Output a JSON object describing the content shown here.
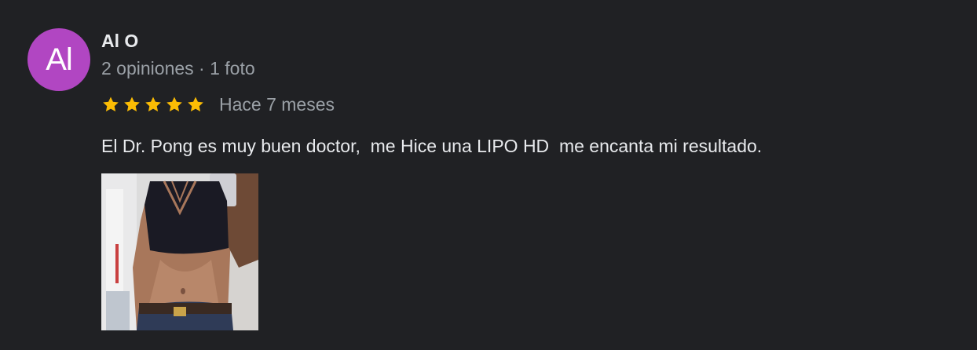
{
  "review": {
    "avatar_initials": "Al",
    "avatar_color": "#b146c2",
    "author_name": "Al O",
    "author_meta": "2 opiniones · 1 foto",
    "rating": 5,
    "rating_max": 5,
    "star_color": "#fbbc04",
    "time_ago": "Hace 7 meses",
    "text": "El Dr. Pong es muy buen doctor,  me Hice una LIPO HD  me encanta mi resultado.",
    "photo_icon": "review-photo"
  }
}
